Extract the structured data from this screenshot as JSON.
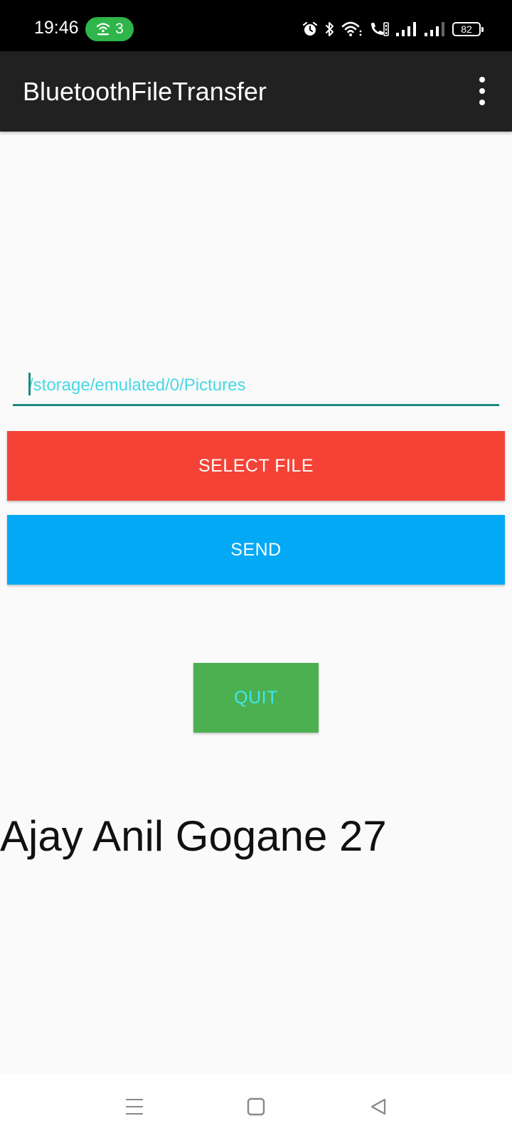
{
  "status_bar": {
    "time": "19:46",
    "hotspot_count": "3",
    "battery_level": "82",
    "icons": [
      "alarm-icon",
      "bluetooth-icon",
      "wifi-icon",
      "call-icon",
      "signal-icon",
      "signal-icon"
    ]
  },
  "app_bar": {
    "title": "BluetoothFileTransfer",
    "overflow_icon": "more-vert-icon"
  },
  "path_input": {
    "value": "/storage/emulated/0/Pictures"
  },
  "buttons": {
    "select_file": "SELECT FILE",
    "send": "SEND",
    "quit": "QUIT"
  },
  "footer_text": "Ajay Anil Gogane 27",
  "colors": {
    "app_bar": "#212121",
    "select_button": "#f44336",
    "send_button": "#03a9f4",
    "quit_button": "#4caf50",
    "quit_text": "#3de8f0",
    "input_text": "#47d8e6",
    "input_underline": "#1b8a80",
    "hotspot_pill": "#2fb54a"
  },
  "nav_bar": {
    "items": [
      "menu-icon",
      "home-icon",
      "back-icon"
    ]
  }
}
